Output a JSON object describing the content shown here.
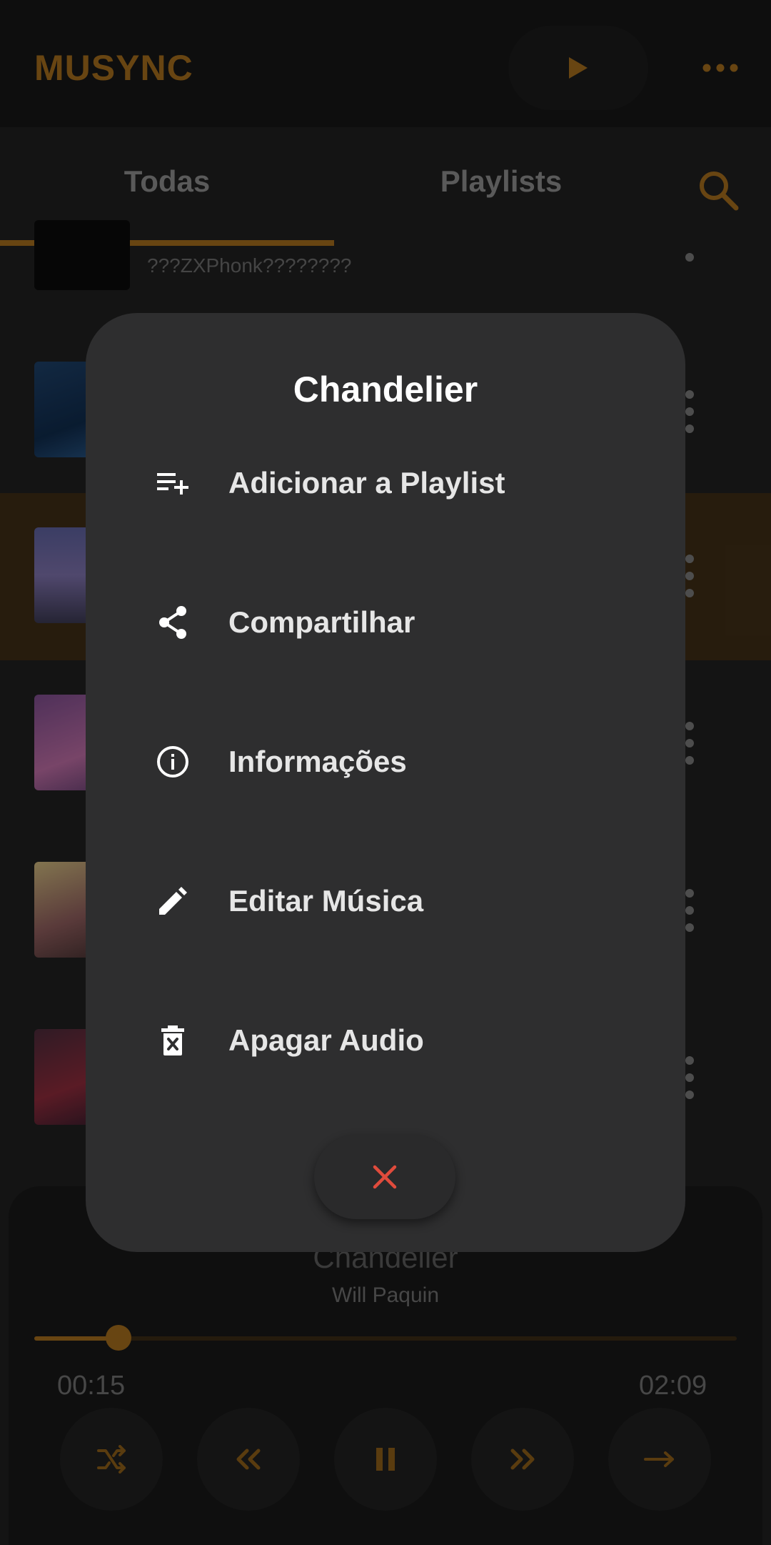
{
  "app": {
    "title": "MUSYNC",
    "accent_color": "#a06a1c",
    "icons": {
      "play": "play-icon",
      "more": "more-horizontal-icon",
      "search": "search-icon"
    }
  },
  "tabs": [
    {
      "label": "Todas",
      "selected": true
    },
    {
      "label": "Playlists",
      "selected": false
    }
  ],
  "list": {
    "partial_row_subtitle": "???ZXPhonk????????"
  },
  "dialog": {
    "title": "Chandelier",
    "items": [
      {
        "label": "Adicionar a Playlist",
        "icon": "playlist-add-icon"
      },
      {
        "label": "Compartilhar",
        "icon": "share-icon"
      },
      {
        "label": "Informações",
        "icon": "info-icon"
      },
      {
        "label": "Editar Música",
        "icon": "edit-pencil-icon"
      },
      {
        "label": "Apagar Audio",
        "icon": "delete-icon"
      }
    ],
    "close_icon": "close-icon",
    "close_color": "#e04b3c"
  },
  "player": {
    "title": "Chandelier",
    "artist": "Will Paquin",
    "current_time": "00:15",
    "total_time": "02:09",
    "progress": 0.12,
    "controls": [
      "shuffle-icon",
      "previous-icon",
      "pause-icon",
      "next-icon",
      "repeat-icon"
    ]
  }
}
